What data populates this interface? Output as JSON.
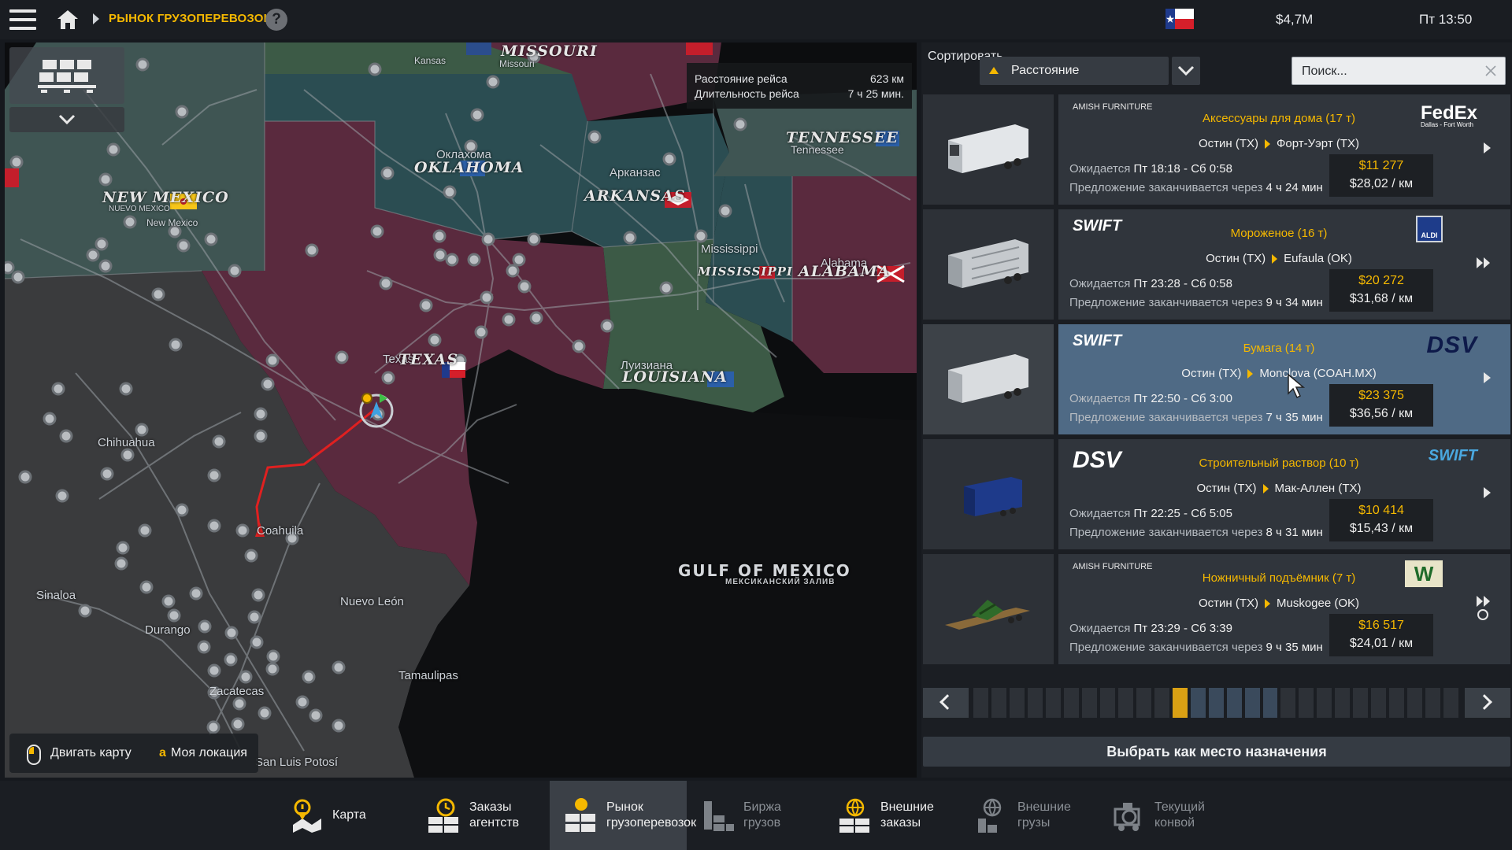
{
  "header": {
    "title": "РЫНОК ГРУЗОПЕРЕВОЗОК",
    "help": "?",
    "money": "$4,7M",
    "time": "Пт 13:50"
  },
  "map": {
    "trip_info": {
      "distance_label": "Расстояние рейса",
      "distance_value": "623 км",
      "duration_label": "Длительность рейса",
      "duration_value": "7 ч 25 мин."
    },
    "labels": {
      "missouri_state": "MISSOURI",
      "missouri": "Missouri",
      "kansas": "Kansas",
      "oklahoma_ru": "Оклахома",
      "oklahoma_state": "OKLAHOMA",
      "new_mexico_state": "NEW MEXICO",
      "new_mexico_es": "NUEVO MEXICO",
      "new_mexico": "New Mexico",
      "arkansas_ru": "Арканзас",
      "arkansas_state": "ARKANSAS",
      "tennessee_state": "TENNESSEE",
      "tennessee": "Tennessee",
      "mississippi": "Mississippi",
      "mississippi_state": "MISSISSIPPI",
      "alabama": "Alabama",
      "alabama_state": "ALABAMA",
      "texas": "Texas",
      "texas_state": "TEXAS",
      "louisiana_ru": "Луизиана",
      "louisiana_state": "LOUISIANA",
      "chihuahua": "Chihuahua",
      "coahuila": "Coahuila",
      "sinaloa": "Sinaloa",
      "durango": "Durango",
      "nuevo_leon": "Nuevo León",
      "zacatecas": "Zacatecas",
      "tamaulipas": "Tamaulipas",
      "san_luis_potosi": "San Luis Potosí",
      "gulf": "GULF OF MEXICO",
      "gulf_ru": "МЕКСИКАНСКИЙ ЗАЛИВ"
    },
    "hint": {
      "move_map": "Двигать карту",
      "key": "a",
      "my_location": "Моя локация"
    }
  },
  "panel": {
    "sort_label": "Сортировать",
    "sort_value": "Расстояние",
    "search_placeholder": "Поиск...",
    "jobs": [
      {
        "company_left": "AMISH FURNITURE",
        "cargo": "Аксессуары для дома (17 т)",
        "from": "Остин (TX)",
        "to": "Форт-Уэрт (TX)",
        "expected_label": "Ожидается",
        "expected": "Пт 18:18 - Сб 0:58",
        "offer_label": "Предложение заканчивается через",
        "offer_time": "4 ч 24 мин",
        "price": "$11 277",
        "per_km": "$28,02 / км",
        "company_right": "FedEx",
        "company_right_sub": "Dallas - Fort Worth"
      },
      {
        "company_left": "SWIFT",
        "cargo": "Мороженое (16 т)",
        "from": "Остин (TX)",
        "to": "Eufaula (OK)",
        "expected_label": "Ожидается",
        "expected": "Пт 23:28 - Сб 0:58",
        "offer_label": "Предложение заканчивается через",
        "offer_time": "9 ч 34 мин",
        "price": "$20 272",
        "per_km": "$31,68 / км",
        "company_right": "ALDI"
      },
      {
        "company_left": "SWIFT",
        "cargo": "Бумага (14 т)",
        "from": "Остин (TX)",
        "to": "Monclova (COAH.MX)",
        "expected_label": "Ожидается",
        "expected": "Пт 22:50 - Сб 3:00",
        "offer_label": "Предложение заканчивается через",
        "offer_time": "7 ч 35 мин",
        "price": "$23 375",
        "per_km": "$36,56 / км",
        "company_right": "DSV"
      },
      {
        "company_left": "DSV",
        "cargo": "Строительный раствор (10 т)",
        "from": "Остин (TX)",
        "to": "Мак-Аллен (TX)",
        "expected_label": "Ожидается",
        "expected": "Пт 22:25 - Сб 5:05",
        "offer_label": "Предложение заканчивается через",
        "offer_time": "8 ч 31 мин",
        "price": "$10 414",
        "per_km": "$15,43 / км",
        "company_right": "SWIFT"
      },
      {
        "company_left": "AMISH FURNITURE",
        "cargo": "Ножничный подъёмник (7 т)",
        "from": "Остин (TX)",
        "to": "Muskogee (OK)",
        "expected_label": "Ожидается",
        "expected": "Пт 23:29 - Сб 3:39",
        "offer_label": "Предложение заканчивается через",
        "offer_time": "9 ч 35 мин",
        "price": "$16 517",
        "per_km": "$24,01 / км",
        "company_right": "W"
      }
    ],
    "pagination": {
      "pages": 27,
      "current": 11
    },
    "select_destination": "Выбрать как место назначения"
  },
  "nav": [
    {
      "label": "Карта",
      "icon": "map-pin-icon"
    },
    {
      "label": "Заказы агентств",
      "icon": "clock-crates-icon"
    },
    {
      "label": "Рынок грузоперевозок",
      "icon": "cargo-market-icon"
    },
    {
      "label": "Биржа грузов",
      "icon": "cargo-exchange-icon"
    },
    {
      "label": "Внешние заказы",
      "icon": "globe-crates-icon"
    },
    {
      "label": "Внешние грузы",
      "icon": "globe-cargo-icon"
    },
    {
      "label": "Текущий конвой",
      "icon": "convoy-icon"
    }
  ],
  "colors": {
    "accent": "#f5b800",
    "selected_row": "#4f6a85",
    "route": "#e02020"
  }
}
